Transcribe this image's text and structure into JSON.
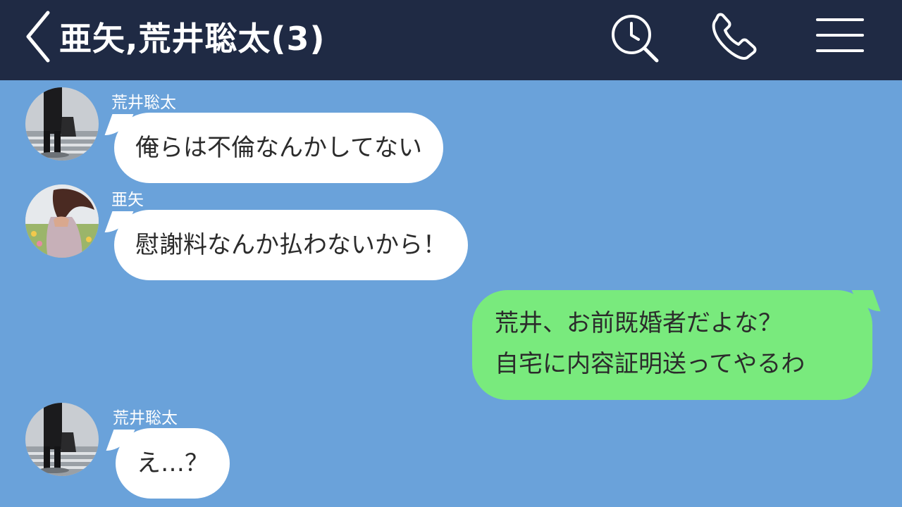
{
  "header": {
    "title": "亜矢,荒井聡太(3)",
    "icons": [
      "back-icon",
      "search-history-icon",
      "phone-icon",
      "menu-icon"
    ]
  },
  "colors": {
    "header_bg": "#1f2a44",
    "chat_bg": "#6aa2da",
    "incoming_bubble": "#ffffff",
    "outgoing_bubble": "#79ea7d"
  },
  "messages": [
    {
      "sender": "荒井聡太",
      "text": "俺らは不倫なんかしてない"
    },
    {
      "sender": "亜矢",
      "text": "慰謝料なんか払わないから！"
    },
    {
      "sender": "",
      "text": "荒井、お前既婚者だよな？\n自宅に内容証明送ってやるわ"
    },
    {
      "sender": "荒井聡太",
      "text": "え…？"
    }
  ]
}
